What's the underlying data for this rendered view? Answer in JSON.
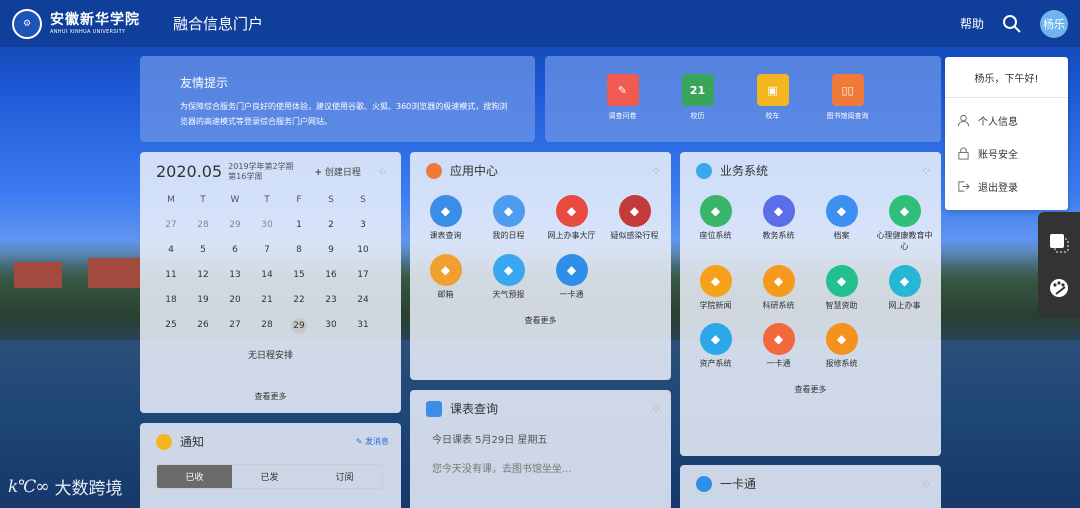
{
  "header": {
    "school_cn": "安徽新华学院",
    "school_en": "ANHUI XINHUA UNIVERSITY",
    "portal_title": "融合信息门户",
    "help": "帮助",
    "avatar": "杨乐"
  },
  "tip": {
    "title": "友情提示",
    "body": "为保障综合服务门户良好的使用体验，建议使用谷歌、火狐、360浏览器的极速模式，搜狗浏览器的高速模式等登录综合服务门户网站。"
  },
  "quick": [
    {
      "label": "调查问卷",
      "icon": "survey-icon",
      "color": "#ef5b50"
    },
    {
      "label": "校历",
      "icon": "calendar-icon",
      "color": "#3aa55a"
    },
    {
      "label": "校车",
      "icon": "bus-icon",
      "color": "#f4b620"
    },
    {
      "label": "图书馆阅查询",
      "icon": "book-icon",
      "color": "#f07a3a"
    }
  ],
  "calendar": {
    "month": "2020.05",
    "semester": "2019学年第2学期",
    "week": "第16学周",
    "add": "创建日程",
    "weekdays": [
      "M",
      "T",
      "W",
      "T",
      "F",
      "S",
      "S"
    ],
    "empty": "无日程安排",
    "more": "查看更多",
    "days": [
      {
        "d": "27",
        "dim": true
      },
      {
        "d": "28",
        "dim": true
      },
      {
        "d": "29",
        "dim": true
      },
      {
        "d": "30",
        "dim": true
      },
      {
        "d": "1"
      },
      {
        "d": "2"
      },
      {
        "d": "3"
      },
      {
        "d": "4"
      },
      {
        "d": "5"
      },
      {
        "d": "6"
      },
      {
        "d": "7"
      },
      {
        "d": "8"
      },
      {
        "d": "9"
      },
      {
        "d": "10"
      },
      {
        "d": "11"
      },
      {
        "d": "12"
      },
      {
        "d": "13"
      },
      {
        "d": "14"
      },
      {
        "d": "15"
      },
      {
        "d": "16"
      },
      {
        "d": "17"
      },
      {
        "d": "18"
      },
      {
        "d": "19"
      },
      {
        "d": "20"
      },
      {
        "d": "21"
      },
      {
        "d": "22"
      },
      {
        "d": "23"
      },
      {
        "d": "24"
      },
      {
        "d": "25"
      },
      {
        "d": "26"
      },
      {
        "d": "27"
      },
      {
        "d": "28"
      },
      {
        "d": "29",
        "today": true
      },
      {
        "d": "30"
      },
      {
        "d": "31"
      }
    ]
  },
  "apps": {
    "title": "应用中心",
    "more": "查看更多",
    "items": [
      {
        "label": "课表查询",
        "color": "#3b8ee8"
      },
      {
        "label": "我的日程",
        "color": "#4e9cf0"
      },
      {
        "label": "网上办事大厅",
        "color": "#e84a3f"
      },
      {
        "label": "疑似感染行程",
        "color": "#c23a3a"
      },
      {
        "label": "邮箱",
        "color": "#f0a030"
      },
      {
        "label": "天气预报",
        "color": "#38a8f0"
      },
      {
        "label": "一卡通",
        "color": "#2f8fe8"
      }
    ]
  },
  "biz": {
    "title": "业务系统",
    "more": "查看更多",
    "items": [
      {
        "label": "座位系统",
        "color": "#39b569"
      },
      {
        "label": "教务系统",
        "color": "#5b6ee8"
      },
      {
        "label": "档案",
        "color": "#3d8ff0"
      },
      {
        "label": "心理健康教育中心",
        "color": "#2ec07a"
      },
      {
        "label": "学院新闻",
        "color": "#f7a11a"
      },
      {
        "label": "科研系统",
        "color": "#f59a1c"
      },
      {
        "label": "智慧资助",
        "color": "#22c08e"
      },
      {
        "label": "网上办事",
        "color": "#26b6d6"
      },
      {
        "label": "资产系统",
        "color": "#2aa8e8"
      },
      {
        "label": "一卡通",
        "color": "#f06a3c"
      },
      {
        "label": "报修系统",
        "color": "#f5921e"
      }
    ]
  },
  "notice": {
    "title": "通知",
    "send": "发消息",
    "tabs": [
      "已收",
      "已发",
      "订阅"
    ]
  },
  "course": {
    "title": "课表查询",
    "today": "今日课表 5月29日 星期五",
    "msg": "您今天没有课，去图书馆坐坐..."
  },
  "ykt": {
    "title": "一卡通"
  },
  "menu": {
    "greeting": "杨乐，下午好!",
    "items": [
      "个人信息",
      "账号安全",
      "退出登录"
    ]
  },
  "watermark": "大数跨境"
}
